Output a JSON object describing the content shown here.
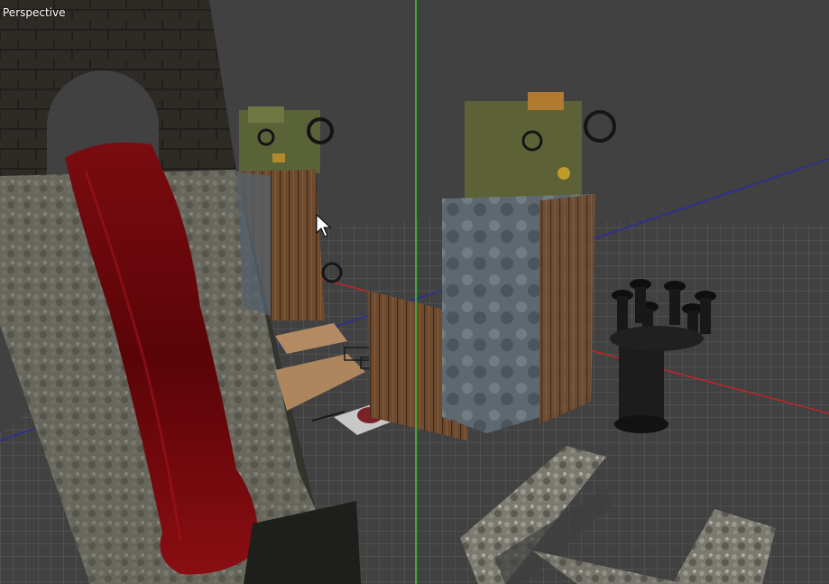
{
  "viewport": {
    "label": "Perspective",
    "background": "#414141",
    "grid_color": "#6e6e6e",
    "axis_colors": {
      "vertical": "#33dd33",
      "red": "#cc2222",
      "blue": "#2a2aaa"
    }
  },
  "cursor": {
    "icon": "arrow-cursor-icon"
  }
}
